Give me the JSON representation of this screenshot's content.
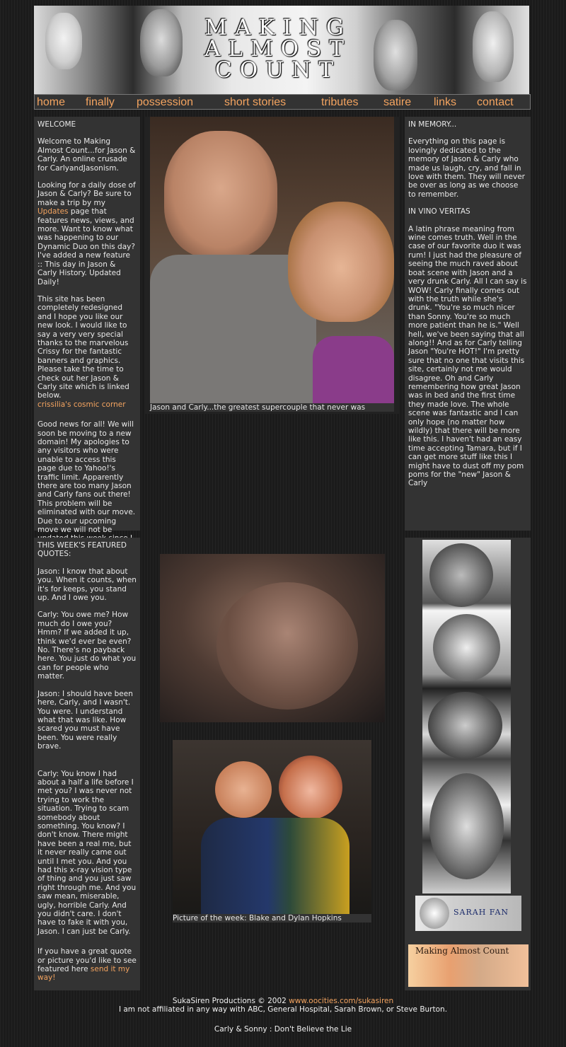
{
  "banner": {
    "title_lines": [
      "MAKING",
      "ALMOST",
      "COUNT"
    ]
  },
  "nav": {
    "items": [
      "home",
      "finally",
      "possession",
      "short stories",
      "tributes",
      "satire",
      "links",
      "contact"
    ]
  },
  "welcome": {
    "heading": "WELCOME",
    "p1": "Welcome to Making Almost Count...for Jason & Carly. An online crusade for CarlyandJasonism.",
    "p2_a": "Looking for a daily dose of Jason & Carly? Be sure to make a trip by my ",
    "p2_link": "Updates",
    "p2_b": " page that features news, views, and more. Want to know what was happening to our Dynamic Duo on this day? I've added a new feature :: This day in Jason & Carly History. Updated Daily!",
    "p3": "This site has been completely redesigned and I hope you like our new look. I would like to say a very very special thanks to the marvelous Crissy for the fantastic banners and graphics. Please take the time to check out her Jason & Carly site which is linked below.",
    "p3_link": "crissilia's cosmic corner",
    "p4": "Good news for all! We will soon be moving to a new domain! My apologies to any visitors who were unable to access this page due to Yahoo!'s traffic limit. Apparently there are too many Jason and Carly fans out there! This problem will be eliminated with our move. Due to our upcoming move we will not be updated this week since I am transferring this site. Please be patient during our move."
  },
  "main_photo": {
    "caption": "Jason and Carly...the greatest supercouple that never was"
  },
  "memory": {
    "heading": "IN MEMORY...",
    "text": "Everything on this page is lovingly dedicated to the memory of Jason & Carly who made us laugh, cry, and fall in love with them. They will never be over as long as we choose to remember.",
    "heading2": "IN VINO VERITAS",
    "text2": "A latin phrase meaning from wine comes truth. Well in the case of our favorite duo it was rum! I just had the pleasure of seeing the much raved about boat scene with Jason and a very drunk Carly. All I can say is WOW! Carly finally comes out with the truth while she's drunk. \"You're so much nicer than Sonny. You're so much more patient than he is.\" Well hell, we've been saying that all along!! And as for Carly telling Jason \"You're HOT!\" I'm pretty sure that no one that visits this site, certainly not me would disagree. Oh and Carly remembering how great Jason was in bed and the first time they made love. The whole scene was fantastic and I can only hope (no matter how wildly) that there will be more like this. I haven't had an easy time accepting Tamara, but if I can get more stuff like this I might have to dust off my pom poms for the \"new\" Jason & Carly"
  },
  "quotes": {
    "heading": "THIS WEEK'S FEATURED QUOTES:",
    "q1": "Jason: I know that about you. When it counts, when it's for keeps, you stand up. And I owe you.",
    "q2": "Carly: You owe me? How much do I owe you? Hmm? If we added it up, think we'd ever be even? No. There's no payback here. You just do what you can for people who matter.",
    "q3": "Jason: I should have been here, Carly, and I wasn't. You were. I understand what that was like. How scared you must have been. You were really brave.",
    "q4": "Carly: You know I had about a half a life before I met you? I was never not trying to work the situation. Trying to scam somebody about something. You know? I don't know. There might have been a real me, but it never really came out until I met you. And you had this x-ray vision type of thing and you just saw right through me. And you saw mean, miserable, ugly, horrible Carly. And you didn't care. I don't have to fake it with you, Jason. I can just be Carly.",
    "q5_a": "If you have a great quote or picture you'd like to see featured here ",
    "q5_link": "send it my way!"
  },
  "week_photo": {
    "caption": "Picture of the week: Blake and Dylan Hopkins"
  },
  "sidebar_badges": {
    "sarah_fan": "SARAH FAN",
    "mac_banner": "Making Almost Count"
  },
  "footer": {
    "line1_a": "SukaSiren Productions © 2002 ",
    "line1_link": "www.oocities.com/sukasiren",
    "line2": "I am not affiliated in any way with ABC, General Hospital, Sarah Brown, or Steve Burton.",
    "line3": "Carly & Sonny : Don't Believe the Lie"
  },
  "colors": {
    "link": "#f4a460",
    "panel": "#333333",
    "background": "#1b1b1b"
  }
}
